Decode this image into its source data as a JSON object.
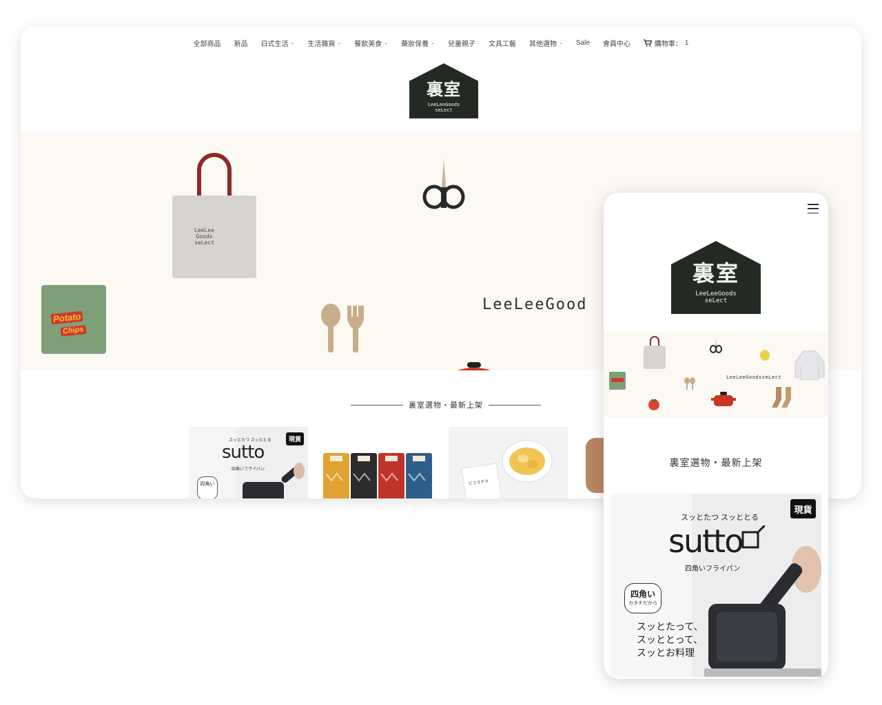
{
  "nav": {
    "items": [
      {
        "label": "全部商品",
        "has_dropdown": false
      },
      {
        "label": "新品",
        "has_dropdown": false
      },
      {
        "label": "日式生活",
        "has_dropdown": true
      },
      {
        "label": "生活雜貨",
        "has_dropdown": true
      },
      {
        "label": "餐飲美食",
        "has_dropdown": true
      },
      {
        "label": "藥妝保養",
        "has_dropdown": true
      },
      {
        "label": "兒童親子",
        "has_dropdown": false
      },
      {
        "label": "文具工藝",
        "has_dropdown": false
      },
      {
        "label": "其他選物",
        "has_dropdown": true
      },
      {
        "label": "Sale",
        "has_dropdown": false
      },
      {
        "label": "會員中心",
        "has_dropdown": false
      }
    ],
    "cart_label": "購物車：",
    "cart_count": "1"
  },
  "logo": {
    "cn": "裏室",
    "en_line1": "LeeLeeGoods",
    "en_line2": "seLect"
  },
  "hero": {
    "title": "LeeLeeGood",
    "tote_text_1": "LeeLee",
    "tote_text_2": "Goods",
    "tote_text_3": "seLect",
    "chips_line1": "Potato",
    "chips_line2": "Chips"
  },
  "section": {
    "title": "裏室選物・最新上架"
  },
  "products": [
    {
      "badge": "現貨",
      "brand_small": "スッとたつ スッととる",
      "brand": "sutto",
      "subtitle": "四角いフライパン",
      "bubble_1": "四角い",
      "bubble_2": "カタチだから"
    },
    {
      "badge": ""
    },
    {
      "badge": "",
      "bag_text": "ピスタチオ"
    },
    {
      "badge": ""
    }
  ],
  "mobile": {
    "hero_title": "LeeLeeGoodsseLect",
    "section_title": "裏室選物・最新上架",
    "product": {
      "badge": "現貨",
      "brand_small": "スッとたつ スッととる",
      "brand": "sutto",
      "subtitle": "四角いフライパン",
      "bubble_1": "四角い",
      "bubble_2": "カタチだから",
      "tagline_1": "スッとたって、",
      "tagline_2": "スッととって、",
      "tagline_3": "スッとお料理"
    }
  },
  "colors": {
    "logo_bg": "#232a24",
    "hero_bg": "#fcf9f2",
    "tote_handle": "#8b2a28",
    "chips_bag": "#7f9f7a",
    "badge_bg": "#111111"
  }
}
